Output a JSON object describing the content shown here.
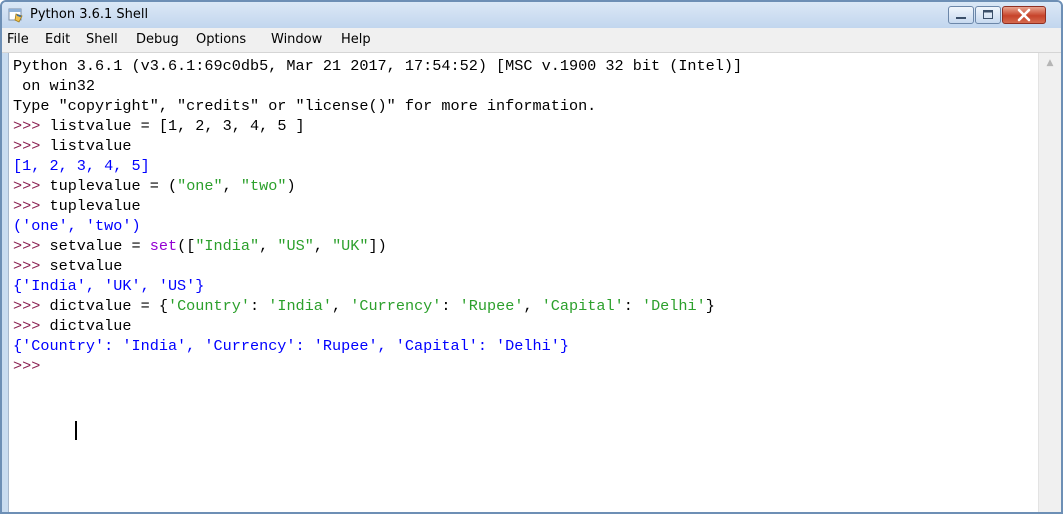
{
  "window": {
    "title": "Python 3.6.1 Shell"
  },
  "menu": {
    "file": "File",
    "edit": "Edit",
    "shell": "Shell",
    "debug": "Debug",
    "options": "Options",
    "window": "Window",
    "help": "Help"
  },
  "shell": {
    "banner1": "Python 3.6.1 (v3.6.1:69c0db5, Mar 21 2017, 17:54:52) [MSC v.1900 32 bit (Intel)]",
    "banner2": " on win32",
    "banner3": "Type \"copyright\", \"credits\" or \"license()\" for more information.",
    "prompt": ">>> ",
    "in1": "listvalue = [1, 2, 3, 4, 5 ]",
    "in2": "listvalue",
    "out2": "[1, 2, 3, 4, 5]",
    "in3_a": "tuplevalue = (",
    "in3_s1": "\"one\"",
    "in3_c": ", ",
    "in3_s2": "\"two\"",
    "in3_e": ")",
    "in4": "tuplevalue",
    "out4": "('one', 'two')",
    "in5_a": "setvalue = ",
    "in5_kw": "set",
    "in5_b": "([",
    "in5_s1": "\"India\"",
    "in5_c1": ", ",
    "in5_s2": "\"US\"",
    "in5_c2": ", ",
    "in5_s3": "\"UK\"",
    "in5_e": "])",
    "in6": "setvalue",
    "out6": "{'India', 'UK', 'US'}",
    "in7_a": "dictvalue = {",
    "in7_s1": "'Country'",
    "in7_c1": ": ",
    "in7_s2": "'India'",
    "in7_c2": ", ",
    "in7_s3": "'Currency'",
    "in7_c3": ": ",
    "in7_s4": "'Rupee'",
    "in7_c4": ", ",
    "in7_s5": "'Capital'",
    "in7_c5": ": ",
    "in7_s6": "'Delhi'",
    "in7_e": "}",
    "in8": "dictvalue",
    "out8": "{'Country': 'India', 'Currency': 'Rupee', 'Capital': 'Delhi'}"
  },
  "icons": {
    "app": "python-shell-icon",
    "minimize": "minimize-icon",
    "maximize": "maximize-icon",
    "close": "close-icon",
    "scroll_up": "scroll-up-arrow-icon"
  }
}
